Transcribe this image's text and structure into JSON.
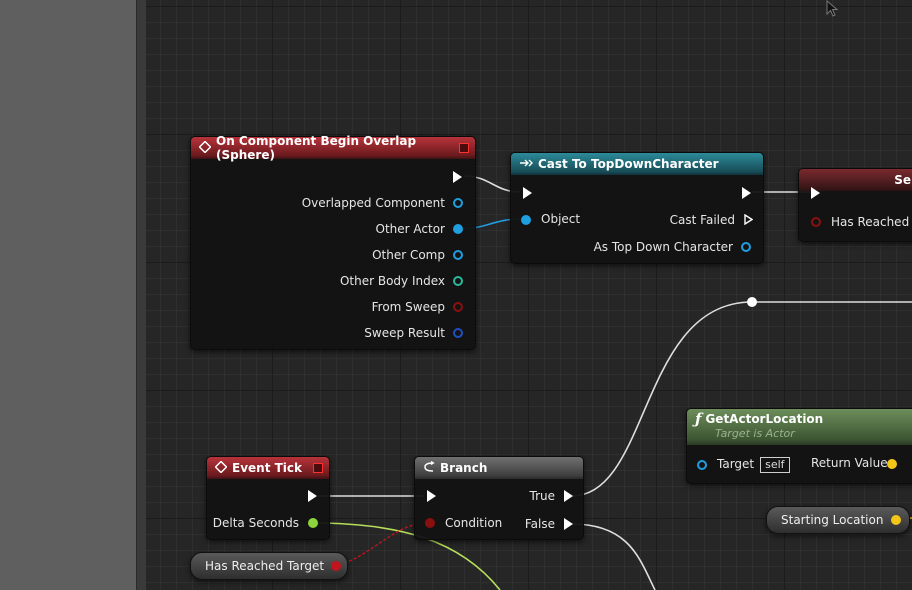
{
  "nodes": {
    "overlap": {
      "title": "On Component Begin Overlap (Sphere)",
      "pins": [
        "Overlapped Component",
        "Other Actor",
        "Other Comp",
        "Other Body Index",
        "From Sweep",
        "Sweep Result"
      ]
    },
    "cast": {
      "title": "Cast To TopDownCharacter",
      "object_label": "Object",
      "cast_failed_label": "Cast Failed",
      "as_label": "As Top Down Character"
    },
    "set_partial": {
      "title": "Se",
      "pin_label": "Has Reached T"
    },
    "event_tick": {
      "title": "Event Tick",
      "delta_label": "Delta Seconds"
    },
    "branch": {
      "title": "Branch",
      "condition_label": "Condition",
      "true_label": "True",
      "false_label": "False"
    },
    "get_actor_location": {
      "title": "GetActorLocation",
      "subtitle": "Target is Actor",
      "target_label": "Target",
      "self_label": "self",
      "return_label": "Return Value"
    },
    "var_has_reached": {
      "label": "Has Reached Target"
    },
    "var_starting_loc": {
      "label": "Starting Location"
    }
  },
  "colors": {
    "object_pin": "#1f9ee0",
    "int_pin": "#2ab89a",
    "bool_pin": "#8a1010",
    "struct_pin": "#2050c0",
    "float_pin": "#8cd53c",
    "vector_pin": "#f5c518",
    "exec_pin": "#ffffff",
    "event_header": "#a62a30",
    "cast_header": "#24808f",
    "pure_header": "#5f7f4e"
  },
  "icons": {
    "event": "diamond-event-icon",
    "cast": "cast-arrow-icon",
    "branch": "branch-icon",
    "function": "function-icon",
    "cursor": "mouse-cursor-icon"
  }
}
